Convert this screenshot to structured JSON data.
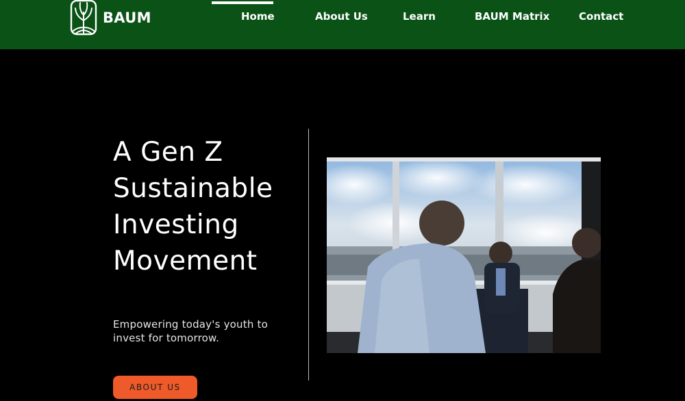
{
  "brand": {
    "name": "BAUM",
    "logo_icon": "tree-icon"
  },
  "nav": {
    "active": "Home",
    "items": [
      {
        "label": "Home"
      },
      {
        "label": "About Us"
      },
      {
        "label": "Learn"
      },
      {
        "label": "BAUM Matrix"
      },
      {
        "label": "Contact"
      }
    ]
  },
  "hero": {
    "title_lines": [
      "A Gen Z",
      "Sustainable",
      "Investing",
      "Movement"
    ],
    "subtitle": "Empowering today's youth to invest for tomorrow.",
    "cta_label": "ABOUT US"
  },
  "colors": {
    "header_bg": "#0a5216",
    "page_bg": "#000000",
    "cta_bg": "#ee5a2a",
    "text": "#ffffff"
  }
}
